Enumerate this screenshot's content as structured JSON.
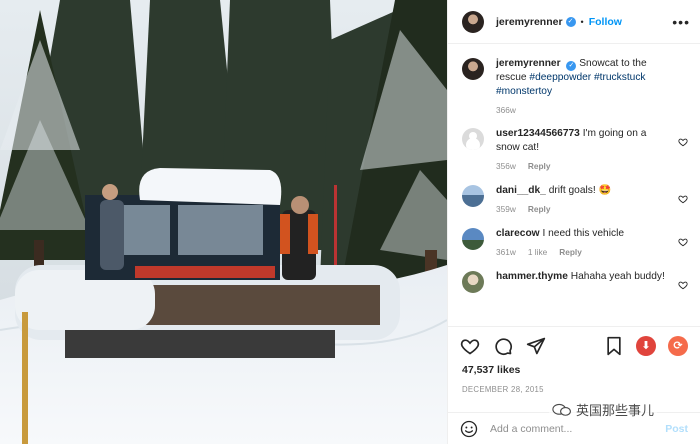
{
  "post": {
    "owner": "jeremyrenner",
    "follow_label": "Follow",
    "separator": "•",
    "more_label": "•••",
    "caption_user": "jeremyrenner",
    "caption_text": "Snowcat to the rescue",
    "caption_tags": "#deeppowder #truckstuck #monstertoy",
    "caption_time": "366w",
    "likes": "47,537 likes",
    "date": "DECEMBER 28, 2015"
  },
  "comments": [
    {
      "user": "user12344566773",
      "text": "I'm going on a snow cat!",
      "time": "356w",
      "likes": "",
      "reply": "Reply",
      "avatar": "default-avatar"
    },
    {
      "user": "dani__dk_",
      "text": "drift goals! 🤩",
      "time": "359w",
      "likes": "",
      "reply": "Reply",
      "avatar": "photo-avatar"
    },
    {
      "user": "clarecow",
      "text": "I need this vehicle",
      "time": "361w",
      "likes": "1 like",
      "reply": "Reply",
      "avatar": "photo-avatar"
    },
    {
      "user": "hammer.thyme",
      "text": "Hahaha yeah buddy!",
      "time": "",
      "likes": "",
      "reply": "",
      "avatar": "photo-avatar"
    }
  ],
  "add_comment": {
    "placeholder": "Add a comment...",
    "post_label": "Post"
  },
  "watermark": {
    "text": "英国那些事儿"
  },
  "icons": {
    "verified": "verified-badge-icon",
    "like": "heart-icon",
    "comment": "comment-icon",
    "share": "paper-plane-icon",
    "save": "bookmark-icon",
    "download": "download-icon",
    "repost": "repost-icon",
    "emoji": "emoji-icon"
  },
  "colors": {
    "link": "#0095f6",
    "hashtag": "#00376b",
    "muted": "#8e8e8e",
    "post_disabled": "#b2dffc"
  }
}
